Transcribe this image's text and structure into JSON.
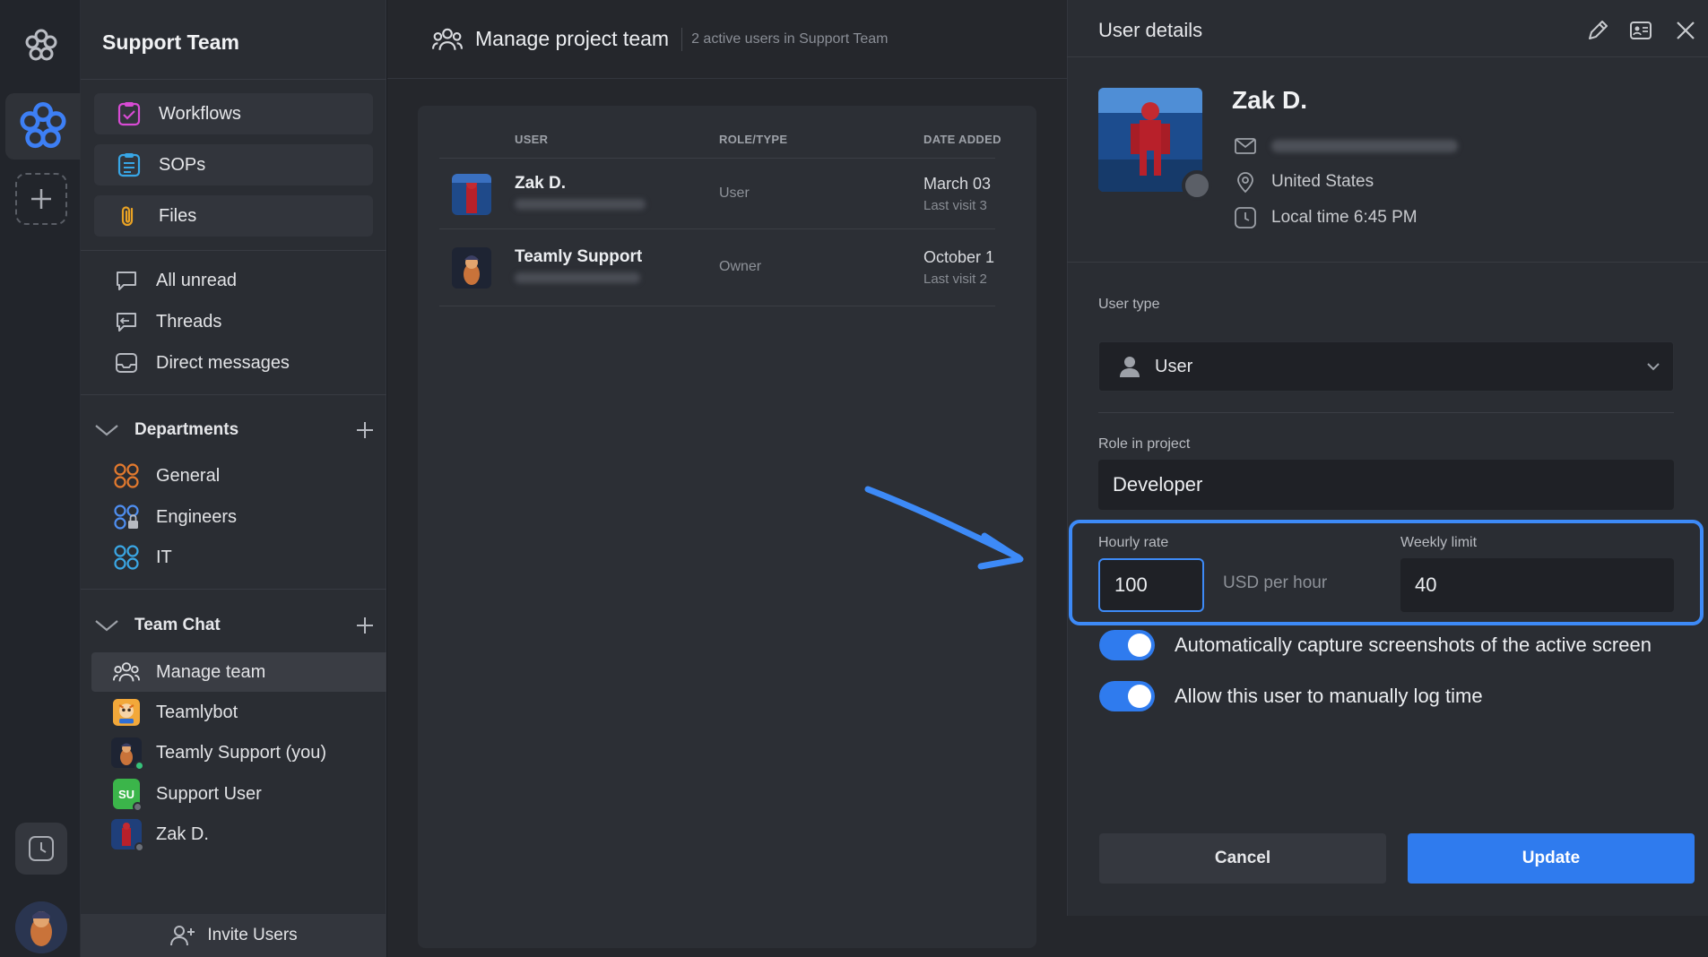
{
  "sidebar": {
    "team_name": "Support Team",
    "cards": [
      {
        "label": "Workflows",
        "icon": "workflows-icon"
      },
      {
        "label": "SOPs",
        "icon": "sops-icon"
      },
      {
        "label": "Files",
        "icon": "paperclip-icon"
      }
    ],
    "items": [
      {
        "label": "All unread",
        "icon": "chat-bubble-icon"
      },
      {
        "label": "Threads",
        "icon": "threads-icon"
      },
      {
        "label": "Direct messages",
        "icon": "inbox-icon"
      }
    ],
    "departments": {
      "title": "Departments",
      "items": [
        {
          "label": "General"
        },
        {
          "label": "Engineers"
        },
        {
          "label": "IT"
        }
      ]
    },
    "team_chat": {
      "title": "Team Chat",
      "items": [
        {
          "label": "Manage team",
          "active": true
        },
        {
          "label": "Teamlybot"
        },
        {
          "label": "Teamly Support (you)"
        },
        {
          "label": "Support User",
          "initials": "SU"
        },
        {
          "label": "Zak D."
        }
      ]
    },
    "invite_label": "Invite Users"
  },
  "main": {
    "title": "Manage project team",
    "subtitle": "2 active users in Support Team",
    "table": {
      "headers": {
        "user": "USER",
        "role": "ROLE/TYPE",
        "date": "DATE ADDED"
      },
      "rows": [
        {
          "name": "Zak D.",
          "role": "User",
          "date": "March 03",
          "last_visit": "Last visit 3"
        },
        {
          "name": "Teamly Support",
          "role": "Owner",
          "date": "October 1",
          "last_visit": "Last visit 2"
        }
      ]
    }
  },
  "details": {
    "title": "User details",
    "name": "Zak D.",
    "country": "United States",
    "local_time": "Local time 6:45 PM",
    "user_type_label": "User type",
    "user_type_value": "User",
    "role_label": "Role in project",
    "role_value": "Developer",
    "hourly_rate_label": "Hourly rate",
    "hourly_rate_value": "100",
    "rate_unit": "USD per hour",
    "weekly_limit_label": "Weekly limit",
    "weekly_limit_value": "40",
    "toggle_screenshots_label": "Automatically capture screenshots of the active screen",
    "toggle_screenshots_on": true,
    "toggle_manual_label": "Allow this user to manually log time",
    "toggle_manual_on": true,
    "cancel_label": "Cancel",
    "update_label": "Update"
  },
  "colors": {
    "accent": "#2f7bee",
    "highlight": "#3d8af7",
    "background": "#1b1d22"
  }
}
